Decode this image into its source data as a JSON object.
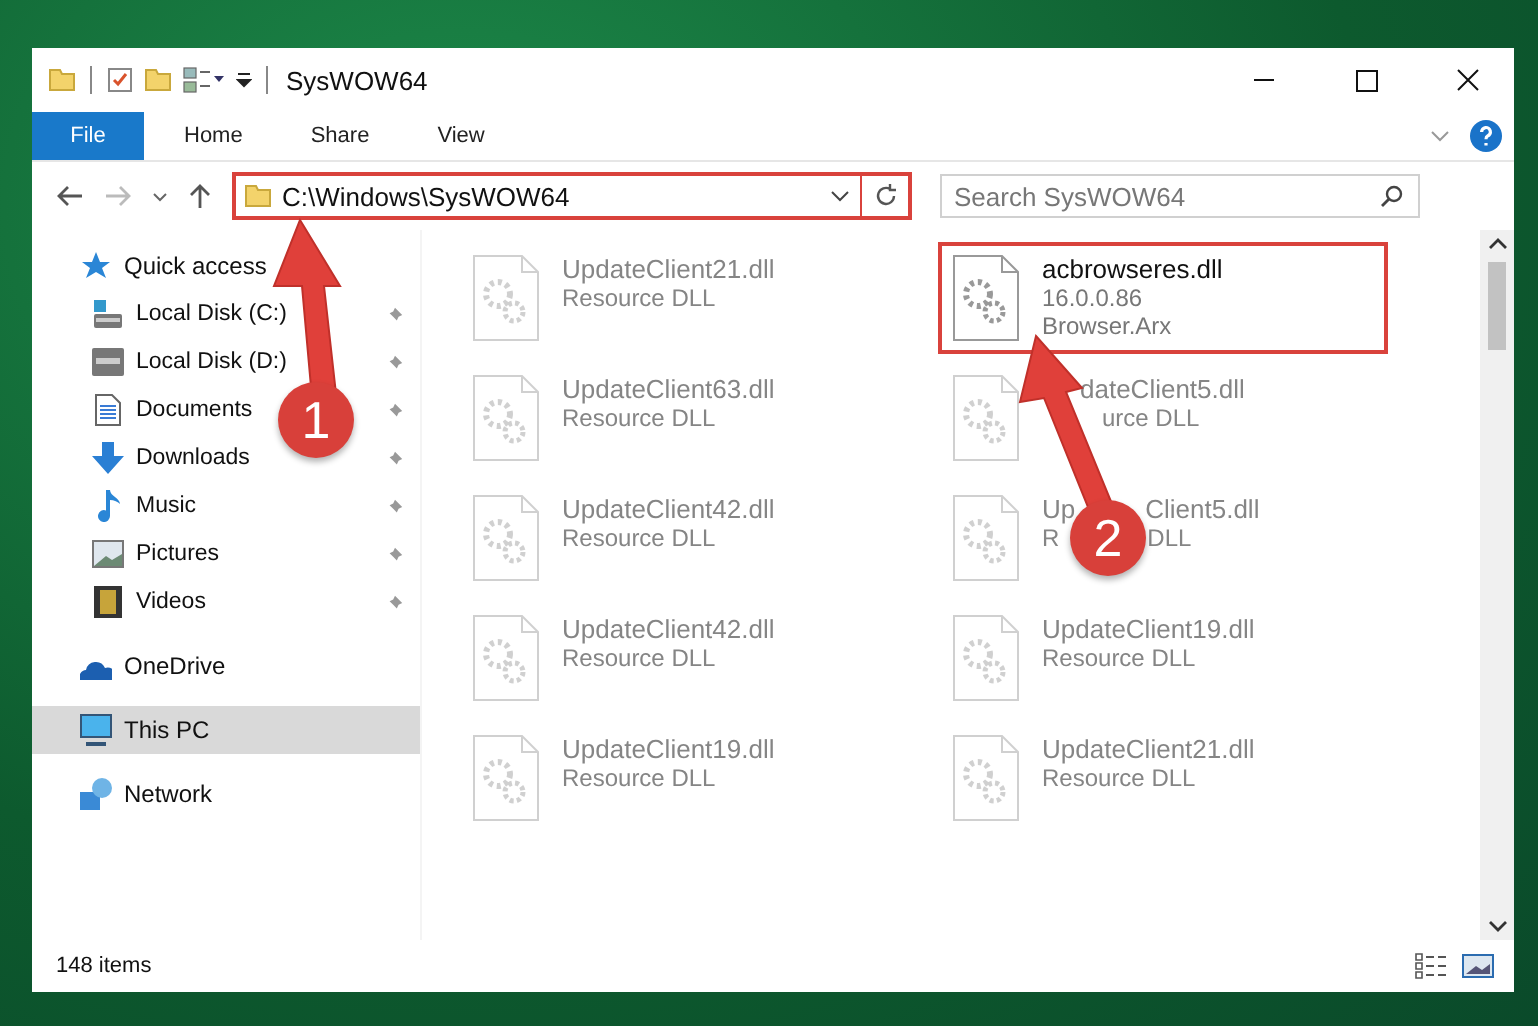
{
  "window": {
    "title": "SysWOW64"
  },
  "ribbon_tabs": [
    {
      "label": "File",
      "kind": "file",
      "selected": false
    },
    {
      "label": "Home",
      "kind": "tab",
      "selected": false
    },
    {
      "label": "Share",
      "kind": "tab",
      "selected": false
    },
    {
      "label": "View",
      "kind": "tab",
      "selected": false
    }
  ],
  "address": {
    "path": "C:\\Windows\\SysWOW64"
  },
  "search": {
    "placeholder": "Search SysWOW64"
  },
  "sidebar": {
    "items": [
      {
        "label": "Quick access",
        "selected": false,
        "children": [
          {
            "label": "Local Disk (C:)",
            "pinned": true,
            "selected": false
          },
          {
            "label": "Local Disk (D:)",
            "pinned": true,
            "selected": false
          },
          {
            "label": "Documents",
            "pinned": true,
            "selected": false
          },
          {
            "label": "Downloads",
            "pinned": true,
            "selected": false
          },
          {
            "label": "Music",
            "pinned": true,
            "selected": false
          },
          {
            "label": "Pictures",
            "pinned": true,
            "selected": false
          },
          {
            "label": "Videos",
            "pinned": true,
            "selected": false
          }
        ]
      },
      {
        "label": "OneDrive",
        "selected": false
      },
      {
        "label": "This PC",
        "selected": true
      },
      {
        "label": "Network",
        "selected": false
      }
    ]
  },
  "files": [
    {
      "kind": "plain",
      "name": "UpdateClient21.dll",
      "line_2": "Resource DLL",
      "blurred": true,
      "selected": false
    },
    {
      "kind": "plain",
      "name": "acbrowseres.dll",
      "line_2": "16.0.0.86",
      "line_3": "Browser.Arx",
      "blurred": false,
      "selected": true
    },
    {
      "kind": "plain",
      "name": "UpdateClient63.dll",
      "line_2": "Resource DLL",
      "blurred": true,
      "selected": false
    },
    {
      "kind": "covered-left",
      "name": "dateClient5.dll",
      "line_2": "urce DLL",
      "blurred": true,
      "selected": false
    },
    {
      "kind": "plain",
      "name": "UpdateClient42.dll",
      "line_2": "Resource DLL",
      "blurred": true,
      "selected": false
    },
    {
      "kind": "split",
      "name_left": "Up",
      "name": "Client5.dll",
      "line_2_left": "R",
      "line_2": "DLL",
      "blurred": true,
      "selected": false
    },
    {
      "kind": "plain",
      "name": "UpdateClient42.dll",
      "line_2": "Resource DLL",
      "blurred": true,
      "selected": false
    },
    {
      "kind": "plain",
      "name": "UpdateClient19.dll",
      "line_2": "Resource DLL",
      "blurred": true,
      "selected": false
    },
    {
      "kind": "plain",
      "name": "UpdateClient19.dll",
      "line_2": "Resource DLL",
      "blurred": true,
      "selected": false
    },
    {
      "kind": "plain",
      "name": "UpdateClient21.dll",
      "line_2": "Resource DLL",
      "blurred": true,
      "selected": false
    }
  ],
  "status_bar": {
    "text": "148 items"
  },
  "annotations": [
    {
      "label": "1",
      "kind": "up"
    },
    {
      "label": "2",
      "kind": "up-left"
    }
  ]
}
